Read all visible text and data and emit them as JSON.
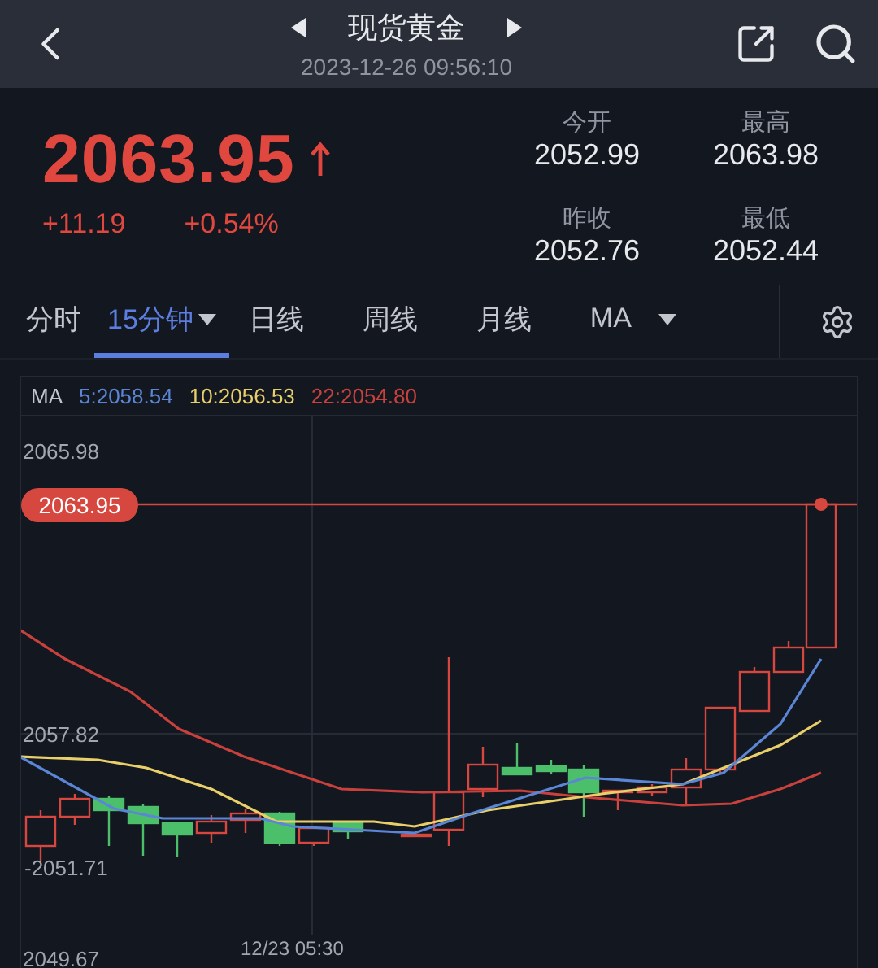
{
  "header": {
    "title": "现货黄金",
    "timestamp": "2023-12-26 09:56:10"
  },
  "quote": {
    "price": "2063.95",
    "change": "+11.19",
    "change_percent": "+0.54%",
    "stats": [
      {
        "label": "今开",
        "value": "2052.99"
      },
      {
        "label": "最高",
        "value": "2063.98"
      },
      {
        "label": "昨收",
        "value": "2052.76"
      },
      {
        "label": "最低",
        "value": "2052.44"
      }
    ]
  },
  "tabs": [
    {
      "label": "分时",
      "selected": false,
      "dropdown": false
    },
    {
      "label": "15分钟",
      "selected": true,
      "dropdown": true
    },
    {
      "label": "日线",
      "selected": false,
      "dropdown": false
    },
    {
      "label": "周线",
      "selected": false,
      "dropdown": false
    },
    {
      "label": "月线",
      "selected": false,
      "dropdown": false
    },
    {
      "label": "MA",
      "selected": false,
      "dropdown": true
    }
  ],
  "chart": {
    "legend_title": "MA",
    "legend": [
      {
        "text": "5:2058.54",
        "color": "#5b86d6"
      },
      {
        "text": "10:2056.53",
        "color": "#e8cf6a"
      },
      {
        "text": "22:2054.80",
        "color": "#c9413c"
      }
    ],
    "price_tag": "2063.95",
    "y_labels": [
      "2065.98",
      "2057.82",
      "-2051.71",
      "2049.67"
    ],
    "x_label": "12/23 05:30"
  }
}
